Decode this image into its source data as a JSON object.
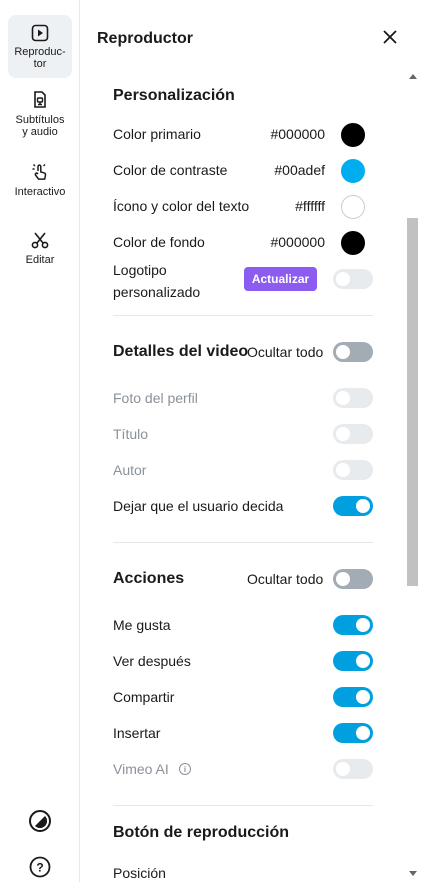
{
  "rail": {
    "items": [
      {
        "label": "Reproduc-\ntor",
        "icon": "play-square-icon",
        "active": true
      },
      {
        "label": "Subtítulos\ny audio",
        "icon": "subtitles-audio-icon",
        "active": false
      },
      {
        "label": "Interactivo",
        "icon": "tap-hand-icon",
        "active": false
      },
      {
        "label": "Editar",
        "icon": "scissors-icon",
        "active": false
      }
    ],
    "bottom_icons": [
      "theme-contrast-icon",
      "help-icon"
    ]
  },
  "panel": {
    "title": "Reproductor",
    "close_icon": "close-icon"
  },
  "personalization": {
    "title": "Personalización",
    "rows": [
      {
        "label": "Color primario",
        "hex": "#000000",
        "color": "#000000"
      },
      {
        "label": "Color de contraste",
        "hex": "#00adef",
        "color": "#00adef"
      },
      {
        "label": "Ícono y color del texto",
        "hex": "#ffffff",
        "color": "#ffffff"
      },
      {
        "label": "Color de fondo",
        "hex": "#000000",
        "color": "#000000"
      }
    ],
    "logo_label": "Logotipo\npersonalizado",
    "logo_button": "Actualizar"
  },
  "video_details": {
    "title": "Detalles del video",
    "hide_all": "Ocultar todo",
    "rows": [
      {
        "label": "Foto del perfil",
        "state": "disabled"
      },
      {
        "label": "Título",
        "state": "disabled"
      },
      {
        "label": "Autor",
        "state": "disabled"
      },
      {
        "label": "Dejar que el usuario decida",
        "state": "on"
      }
    ]
  },
  "actions": {
    "title": "Acciones",
    "hide_all": "Ocultar todo",
    "rows": [
      {
        "label": "Me gusta",
        "state": "on"
      },
      {
        "label": "Ver después",
        "state": "on"
      },
      {
        "label": "Compartir",
        "state": "on"
      },
      {
        "label": "Insertar",
        "state": "on"
      },
      {
        "label": "Vimeo AI",
        "state": "disabled"
      }
    ]
  },
  "play_button": {
    "title": "Botón de reproducción",
    "position_label": "Posición"
  },
  "colors": {
    "accent": "#00a0e0",
    "update_button": "#8c5cf0",
    "toggle_off": "#a3abb5",
    "toggle_disabled": "#e8ebee"
  }
}
